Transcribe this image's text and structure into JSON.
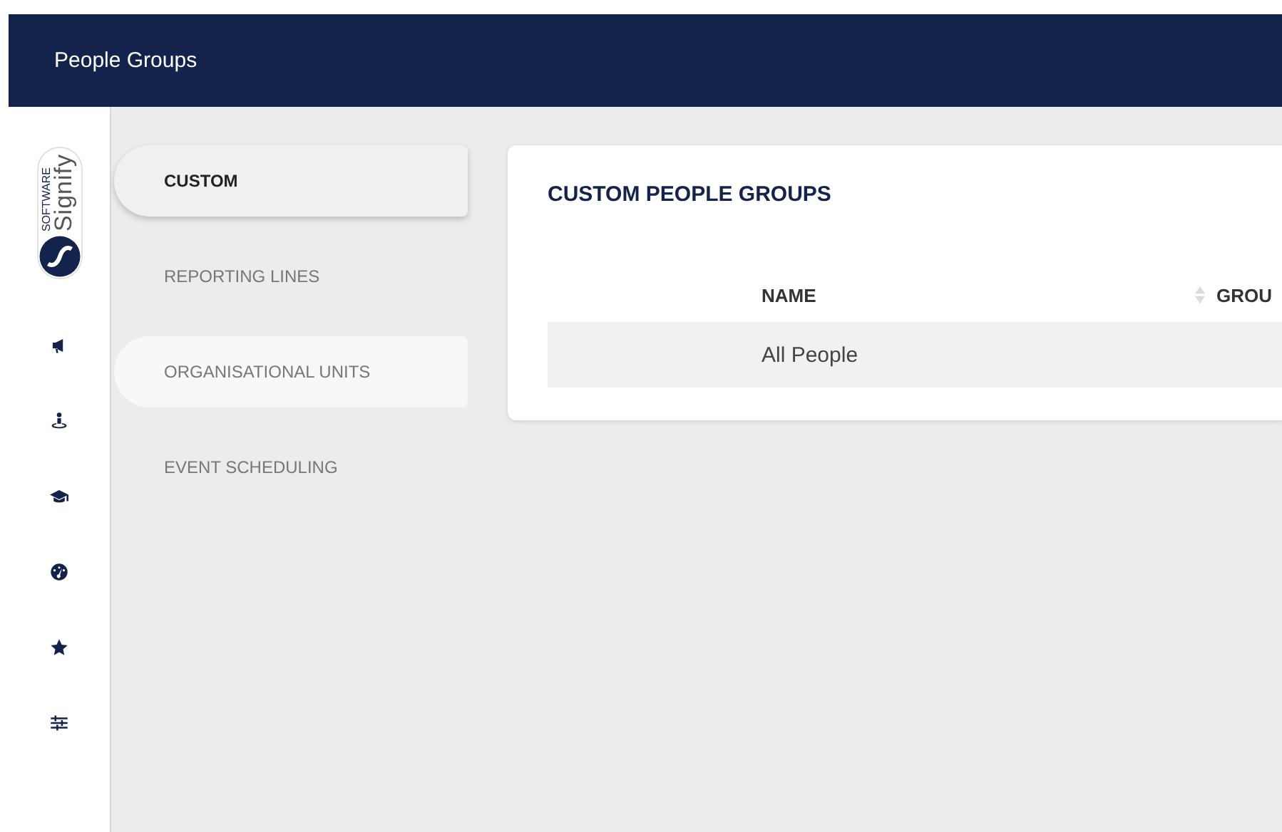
{
  "header": {
    "title": "People Groups"
  },
  "logo": {
    "name": "Signify",
    "tagline": "SOFTWARE"
  },
  "sidebar": {
    "items": [
      {
        "kind": "megaphone"
      },
      {
        "kind": "person-pin"
      },
      {
        "kind": "cap"
      },
      {
        "kind": "gauge"
      },
      {
        "kind": "star"
      },
      {
        "kind": "sliders"
      }
    ]
  },
  "nav": [
    {
      "label": "CUSTOM",
      "selected": true,
      "hovered": false
    },
    {
      "label": "REPORTING LINES",
      "selected": false,
      "hovered": false
    },
    {
      "label": "ORGANISATIONAL UNITS",
      "selected": false,
      "hovered": true
    },
    {
      "label": "EVENT SCHEDULING",
      "selected": false,
      "hovered": false
    }
  ],
  "card": {
    "title": "CUSTOM PEOPLE GROUPS",
    "table": {
      "columns": [
        {
          "label": "NAME",
          "sortable": true
        },
        {
          "label": "GROU",
          "sortable": false
        }
      ],
      "rows": [
        {
          "cells": [
            "All People"
          ],
          "selected": true
        }
      ]
    }
  }
}
